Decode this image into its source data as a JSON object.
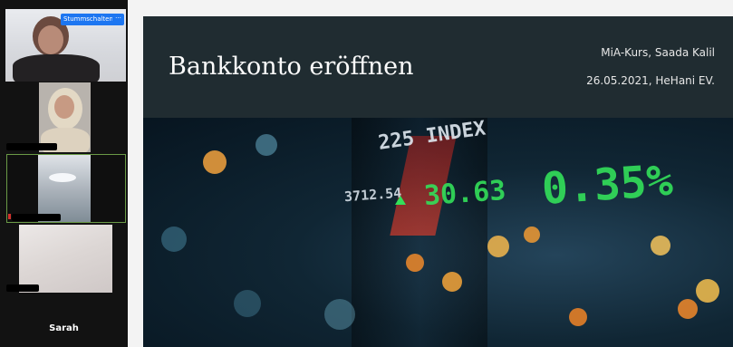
{
  "gallery": {
    "mute_label": "Stummschalten",
    "more_label": "···",
    "participant_name": "Sarah"
  },
  "slide": {
    "title": "Bankkonto eröffnen",
    "course": "MiA-Kurs, Saada Kalil",
    "date_org": "26.05.2021, HeHani EV."
  },
  "ticker": {
    "index": "225 INDEX",
    "left_value": "3712.54",
    "mid_value": "30.63",
    "right_value": "0.35%"
  },
  "colors": {
    "slide_bg": "#1f2a30",
    "zoom_blue": "#1d76f1",
    "ticker_green": "#33e05a"
  }
}
